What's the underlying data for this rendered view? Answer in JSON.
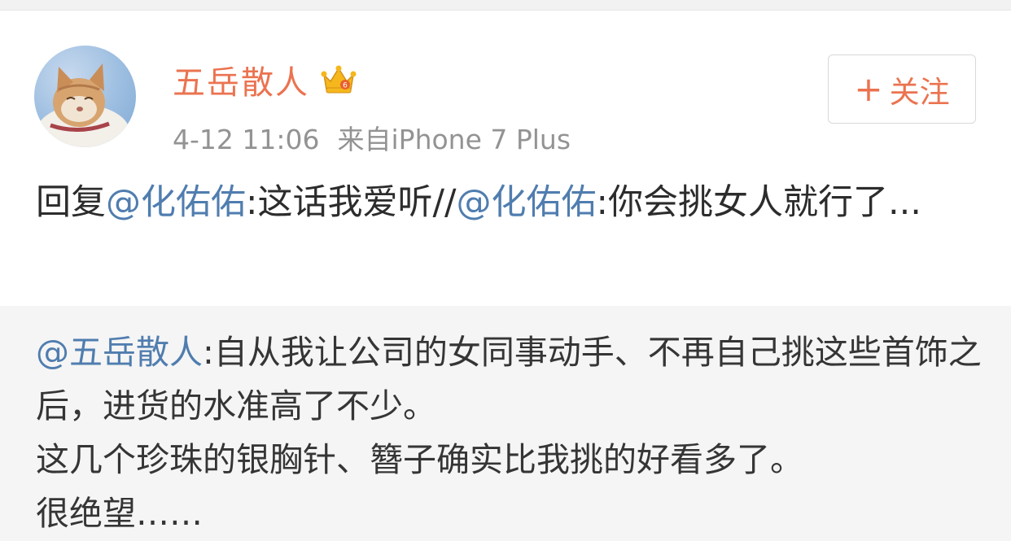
{
  "post": {
    "author": "五岳散人",
    "time": "4-12 11:06",
    "source": "来自iPhone 7 Plus",
    "follow_plus": "+",
    "follow_label": "关注",
    "text": {
      "prefix": "回复",
      "mention1": "@化佑佑",
      "part1": ":这话我爱听//",
      "mention2": "@化佑佑",
      "part2": ":你会挑女人就行了..."
    }
  },
  "quote": {
    "mention": "@五岳散人",
    "line1": ":自从我让公司的女同事动手、不再自己挑这些首饰之后，进货的水准高了不少。",
    "line2": "这几个珍珠的银胸针、簪子确实比我挑的好看多了。",
    "line3": "很绝望……"
  },
  "colors": {
    "accent": "#eb7350",
    "link": "#507daf",
    "meta": "#939393",
    "quote_bg": "#f5f5f5"
  },
  "icons": {
    "avatar": "cat-avatar",
    "badge": "crown-badge-icon"
  }
}
